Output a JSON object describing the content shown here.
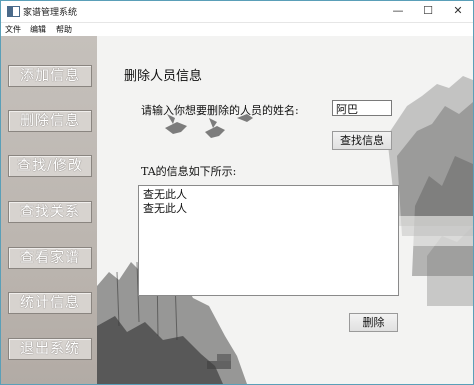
{
  "window": {
    "title": "家谱管理系统",
    "min_symbol": "—",
    "max_symbol": "☐",
    "close_symbol": "✕"
  },
  "menu": [
    "文件",
    "编辑",
    "帮助"
  ],
  "sidebar": {
    "items": [
      {
        "label": "添加信息"
      },
      {
        "label": "删除信息"
      },
      {
        "label": "查找/修改"
      },
      {
        "label": "查找关系"
      },
      {
        "label": "查看家谱"
      },
      {
        "label": "统计信息"
      },
      {
        "label": "退出系统"
      }
    ]
  },
  "main": {
    "heading": "删除人员信息",
    "prompt": "请输入你想要删除的人员的姓名:",
    "name_value": "阿巴",
    "find_button": "查找信息",
    "info_label": "TA的信息如下所示:",
    "info_lines": [
      "查无此人",
      "",
      "查无此人"
    ],
    "delete_button": "删除"
  }
}
